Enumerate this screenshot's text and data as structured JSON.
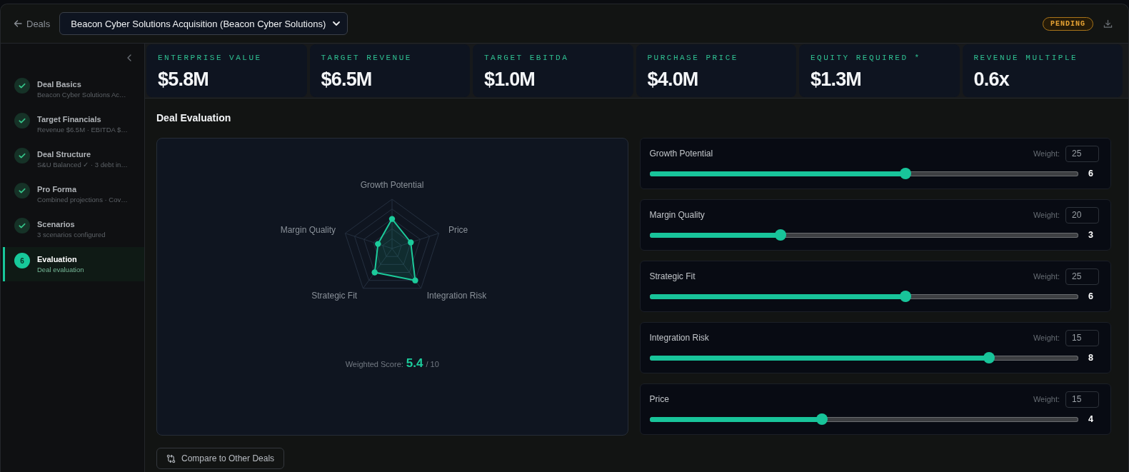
{
  "header": {
    "back_link": "Deals",
    "deal_select": {
      "value": "Beacon Cyber Solutions Acquisition (Beacon Cyber Solutions)"
    },
    "status_badge": "PENDING"
  },
  "sidebar": {
    "items": [
      {
        "title": "Deal Basics",
        "subtitle": "Beacon Cyber Solutions Ac…",
        "completed": true,
        "selected": false
      },
      {
        "title": "Target Financials",
        "subtitle": "Revenue $6.5M · EBITDA $…",
        "completed": true,
        "selected": false
      },
      {
        "title": "Deal Structure",
        "subtitle": "S&U Balanced ✓ · 3 debt in…",
        "completed": true,
        "selected": false
      },
      {
        "title": "Pro Forma",
        "subtitle": "Combined projections · Cov…",
        "completed": true,
        "selected": false
      },
      {
        "title": "Scenarios",
        "subtitle": "3 scenarios configured",
        "completed": true,
        "selected": false
      },
      {
        "title": "Evaluation",
        "subtitle": "Deal evaluation",
        "step": "6",
        "completed": false,
        "selected": true
      }
    ]
  },
  "kpis": [
    {
      "label": "ENTERPRISE VALUE",
      "value": "$5.8M"
    },
    {
      "label": "TARGET REVENUE",
      "value": "$6.5M"
    },
    {
      "label": "TARGET EBITDA",
      "value": "$1.0M"
    },
    {
      "label": "PURCHASE PRICE",
      "value": "$4.0M"
    },
    {
      "label": "EQUITY REQUIRED *",
      "value": "$1.3M"
    },
    {
      "label": "REVENUE MULTIPLE",
      "value": "0.6x"
    }
  ],
  "evaluation": {
    "title": "Deal Evaluation",
    "radar": {
      "axis_labels": [
        "Growth Potential",
        "Margin Quality",
        "Price",
        "Strategic Fit",
        "Integration Risk"
      ]
    },
    "weighted_score": {
      "label": "Weighted Score:",
      "value": "5.4",
      "scale": "/ 10"
    },
    "criteria": [
      {
        "name": "Growth Potential",
        "weight_label": "Weight:",
        "weight": "25",
        "score": "6",
        "level": 0.6
      },
      {
        "name": "Margin Quality",
        "weight_label": "Weight:",
        "weight": "20",
        "score": "3",
        "level": 0.3
      },
      {
        "name": "Strategic Fit",
        "weight_label": "Weight:",
        "weight": "25",
        "score": "6",
        "level": 0.6
      },
      {
        "name": "Integration Risk",
        "weight_label": "Weight:",
        "weight": "15",
        "score": "8",
        "level": 0.8
      },
      {
        "name": "Price",
        "weight_label": "Weight:",
        "weight": "15",
        "score": "4",
        "level": 0.4
      }
    ]
  },
  "compare_button": "Compare to Other Deals"
}
